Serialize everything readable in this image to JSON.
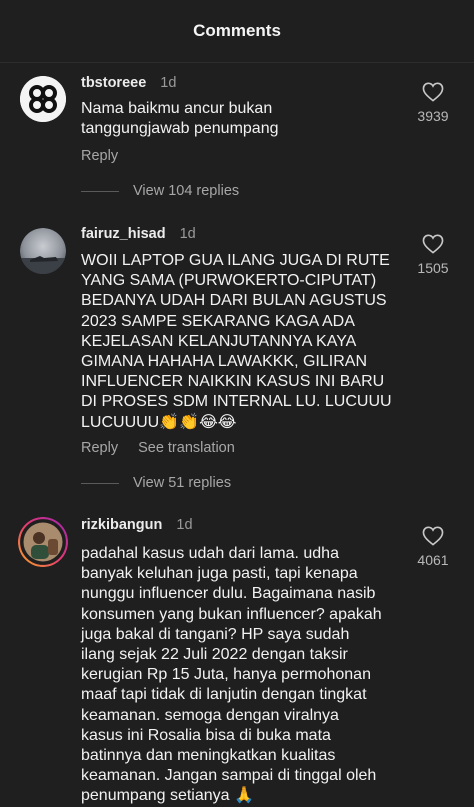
{
  "header": {
    "title": "Comments"
  },
  "comments": [
    {
      "username": "tbstoreee",
      "time": "1d",
      "text": "Nama baikmu ancur bukan\ntanggungjawab penumpang",
      "likes": "3939",
      "reply_label": "Reply",
      "view_replies": "View 104 replies"
    },
    {
      "username": "fairuz_hisad",
      "time": "1d",
      "text": "WOII LAPTOP GUA ILANG JUGA DI RUTE\nYANG SAMA (PURWOKERTO-CIPUTAT)\nBEDANYA UDAH DARI BULAN AGUSTUS\n2023  SAMPE SEKARANG KAGA ADA\nKEJELASAN KELANJUTANNYA KAYA\nGIMANA HAHAHA LAWAKKK, GILIRAN\nINFLUENCER NAIKKIN KASUS INI BARU\nDI PROSES SDM INTERNAL LU. LUCUUU\nLUCUUUU👏👏😂😂",
      "likes": "1505",
      "reply_label": "Reply",
      "translate_label": "See translation",
      "view_replies": "View 51 replies"
    },
    {
      "username": "rizkibangun",
      "time": "1d",
      "text": "padahal kasus udah dari lama. udha\nbanyak keluhan juga pasti, tapi kenapa\nnunggu influencer dulu. Bagaimana nasib\nkonsumen yang bukan influencer? apakah\njuga bakal di tangani? HP saya sudah\nilang sejak 22 Juli 2022 dengan taksir\nkerugian Rp 15 Juta, hanya permohonan\nmaaf tapi tidak di lanjutin dengan tingkat\nkeamanan. semoga dengan viralnya\nkasus ini Rosalia bisa di buka mata\nbatinnya dan meningkatkan kualitas\nkeamanan. Jangan sampai di tinggal oleh\npenumpang setianya 🙏",
      "likes": "4061"
    }
  ]
}
